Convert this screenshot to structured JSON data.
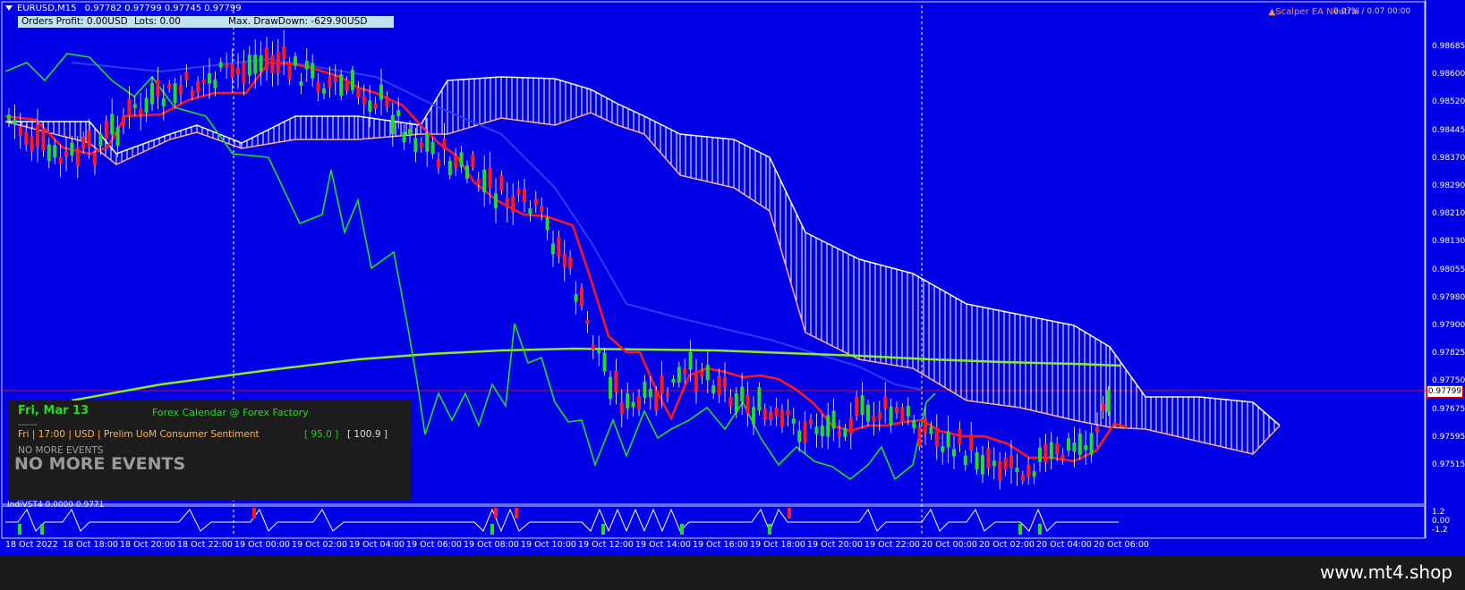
{
  "header": {
    "symbol": "EURUSD,M15",
    "ohlc": "0.97782 0.97799 0.97745 0.97799"
  },
  "info_panel": {
    "orders_profit": "Orders Profit: 0.00USD",
    "lots": "Lots: 0.00",
    "max_drawdown": "Max. DrawDown: -629.90USD"
  },
  "corner_label": "Scalper EA Neutral",
  "corner_label2": "0.07% / 0.07 00:00",
  "price_axis": {
    "ticks": [
      "0.98685",
      "0.98600",
      "0.98520",
      "0.98445",
      "0.98370",
      "0.98290",
      "0.98210",
      "0.98130",
      "0.98055",
      "0.97980",
      "0.97900",
      "0.97825",
      "0.97750",
      "0.97675",
      "0.97595",
      "0.97515"
    ],
    "current_price": "0.97799"
  },
  "calendar": {
    "date": "Fri, Mar 13",
    "title": "Forex Calendar @ Forex Factory",
    "separator": "------",
    "event": "Fri  |  17:00  |  USD  |  Prelim UoM Consumer Sentiment",
    "actual": "[ 95.0 ]",
    "forecast": "[ 100.9 ]",
    "no_more_small": "NO MORE EVENTS",
    "no_more_large": "NO MORE EVENTS"
  },
  "subwindow": {
    "label": "IndiVST4 0.0000 0.9771",
    "axis": [
      "1.2",
      "0.00",
      "-1.2"
    ]
  },
  "time_axis": [
    "18 Oct 2022",
    "18 Oct 18:00",
    "18 Oct 20:00",
    "18 Oct 22:00",
    "19 Oct 00:00",
    "19 Oct 02:00",
    "19 Oct 04:00",
    "19 Oct 06:00",
    "19 Oct 08:00",
    "19 Oct 10:00",
    "19 Oct 12:00",
    "19 Oct 14:00",
    "19 Oct 16:00",
    "19 Oct 18:00",
    "19 Oct 20:00",
    "19 Oct 22:00",
    "20 Oct 00:00",
    "20 Oct 02:00",
    "20 Oct 04:00",
    "20 Oct 06:00"
  ],
  "watermark": "www.mt4.shop",
  "colors": {
    "background": "#0000e6",
    "bull_candle": "#22dd22",
    "bear_candle": "#ff1a1a",
    "ma_red": "#ff1a1a",
    "ma_lime": "#88ee22",
    "chikou_green": "#22dd22",
    "kijun_blue": "#2a3cff",
    "cloud_upper": "#ffffff",
    "cloud_lower": "#ffb38a"
  },
  "icons": [
    "chart-dropdown-triangle-icon",
    "warning-triangle-icon"
  ]
}
